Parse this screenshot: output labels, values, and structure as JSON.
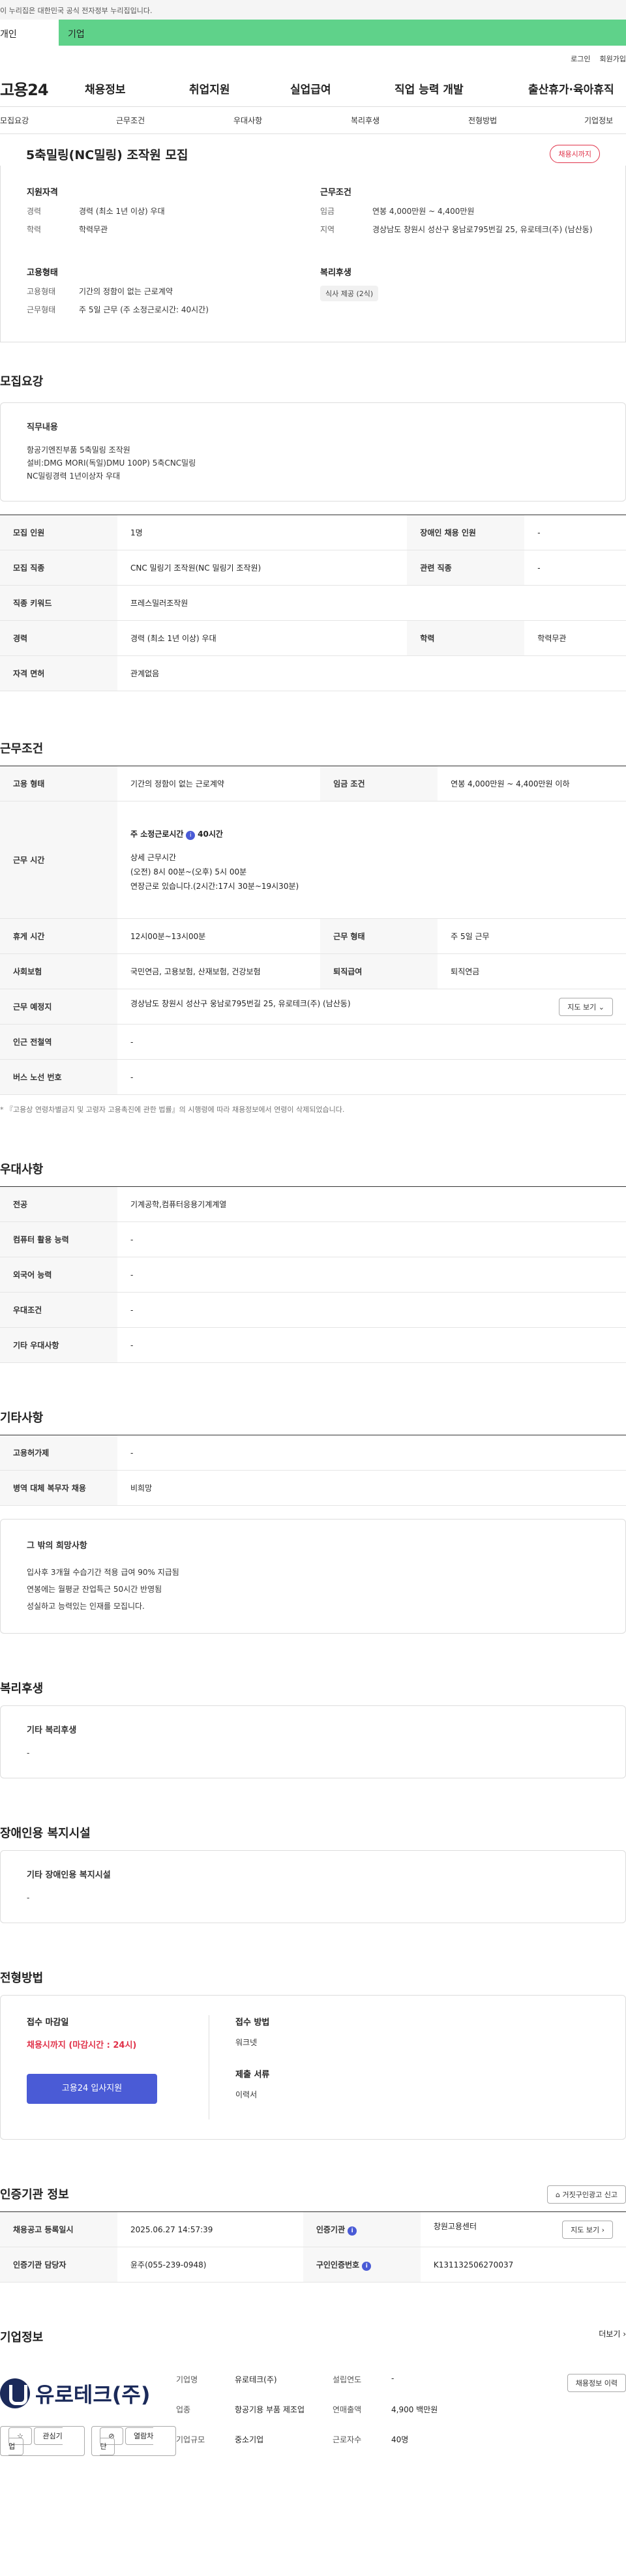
{
  "gov_bar": "이 누리집은 대한민국 공식 전자정부 누리집입니다.",
  "top_tabs": [
    "개인",
    "기업"
  ],
  "util": [
    "로그인",
    "회원가입"
  ],
  "gnb": {
    "logo": "고용24",
    "menu": [
      "채용정보",
      "취업지원",
      "실업급여",
      "직업 능력 개발",
      "출산휴가·육아휴직"
    ]
  },
  "subnav": [
    "모집요강",
    "근무조건",
    "우대사항",
    "복리후생",
    "전형방법",
    "기업정보"
  ],
  "job": {
    "title": "5축밀링(NC밀링) 조작원 모집",
    "badge": "채용시까지"
  },
  "summary": {
    "qual_title": "지원자격",
    "qual_rows": [
      {
        "k": "경력",
        "v": "경력 (최소 1년 이상) 우대"
      },
      {
        "k": "학력",
        "v": "학력무관"
      }
    ],
    "work_title": "근무조건",
    "work_rows": [
      {
        "k": "임금",
        "v": "연봉 4,000만원 ~ 4,400만원"
      },
      {
        "k": "지역",
        "v": "경상남도 창원시 성산구 웅남로795번길 25, 유로테크(주) (남산동)"
      }
    ],
    "emp_title": "고용형태",
    "emp_rows": [
      {
        "k": "고용형태",
        "v": "기간의 정함이 없는 근로계약"
      },
      {
        "k": "근무형태",
        "v": "주 5일 근무 (주 소정근로시간: 40시간)"
      }
    ],
    "welfare_title": "복리후생",
    "welfare_chip": "식사 제공 (2식)"
  },
  "recruit": {
    "title": "모집요강",
    "duty_title": "직무내용",
    "duty_lines": [
      "항공기엔진부품 5축밀링 조작원",
      "설비:DMG MORI(독일)DMU 100P) 5축CNC밀링",
      "NC밀링경력 1년이상자 우대"
    ],
    "rows": [
      [
        "모집 인원",
        "1명",
        "장애인 채용 인원",
        "-"
      ],
      [
        "모집 직종",
        "CNC 밀링기 조작원(NC 밀링기 조작원)",
        "관련 직종",
        "-"
      ],
      [
        "직종 키워드",
        "프레스밀러조작원"
      ],
      [
        "경력",
        "경력 (최소 1년 이상) 우대",
        "학력",
        "학력무관"
      ],
      [
        "자격 면허",
        "관계없음"
      ]
    ]
  },
  "conditions": {
    "title": "근무조건",
    "r1": [
      "고용 형태",
      "기간의 정함이 없는 근로계약",
      "임금 조건",
      "연봉 4,000만원 ~ 4,400만원 이하"
    ],
    "hours_label": "근무 시간",
    "hours_main": "주 소정근로시간",
    "hours_value": "40시간",
    "hours_detail_title": "상세 근무시간",
    "hours_detail": [
      "(오전) 8시 00분~(오후) 5시 00분",
      "연장근로 있습니다.(2시간:17시 30분~19시30분)"
    ],
    "r3": [
      "휴게 시간",
      "12시00분~13시00분",
      "근무 형태",
      "주 5일 근무"
    ],
    "r4": [
      "사회보험",
      "국민연금, 고용보험, 산재보험, 건강보험",
      "퇴직급여",
      "퇴직연금"
    ],
    "r5": [
      "근무 예정지",
      "경상남도 창원시 성산구 웅남로795번길 25, 유로테크(주) (남산동)",
      "지도 보기"
    ],
    "r6": [
      "인근 전철역",
      "-"
    ],
    "r7": [
      "버스 노선 번호",
      "-"
    ],
    "note": "* 『고용상 연령차별금지 및 고령자 고용촉진에 관한 법률』의 시행령에 따라 채용정보에서 연령이 삭제되었습니다."
  },
  "preference": {
    "title": "우대사항",
    "rows": [
      [
        "전공",
        "기계공학,컴퓨터응용기계계열"
      ],
      [
        "컴퓨터 활용 능력",
        "-"
      ],
      [
        "외국어 능력",
        "-"
      ],
      [
        "우대조건",
        "-"
      ],
      [
        "기타 우대사항",
        "-"
      ]
    ]
  },
  "etc": {
    "title": "기타사항",
    "rows": [
      [
        "고용허가제",
        "-"
      ],
      [
        "병역 대체 복무자 채용",
        "비희망"
      ]
    ],
    "wish_title": "그 밖의 희망사항",
    "wish_lines": [
      "입사후 3개월 수습기간 적용 급여 90% 지급됨",
      "연봉에는 월평균 잔업특근 50시간 반영됨",
      "성실하고 능력있는 인재를 모집니다."
    ]
  },
  "welfare": {
    "title": "복리후생",
    "sub": "기타 복리후생",
    "val": "-"
  },
  "disabled": {
    "title": "장애인용 복지시설",
    "sub": "기타 장애인용 복지시설",
    "val": "-"
  },
  "process": {
    "title": "전형방법",
    "deadline_label": "접수 마감일",
    "deadline": "채용시까지 (마감시간 : 24시)",
    "apply_button": "고용24 입사지원",
    "method_label": "접수 방법",
    "method": "워크넷",
    "docs_label": "제출 서류",
    "docs": "이력서"
  },
  "agency": {
    "title": "인증기관 정보",
    "report_button": "거짓구인광고 신고",
    "r1": [
      "채용공고 등록일시",
      "2025.06.27 14:57:39",
      "인증기관",
      "창원고용센터",
      "지도 보기"
    ],
    "r2": [
      "인증기관 담당자",
      "윤주(055-239-0948)",
      "구인인증번호",
      "K131132506270037"
    ]
  },
  "company": {
    "title": "기업정보",
    "more": "더보기",
    "logo_text": "유로테크(주)",
    "interest_button": "관심기업",
    "block_button": "열람차단",
    "info": [
      [
        "기업명",
        "유로테크(주)",
        "설립연도",
        "-"
      ],
      [
        "업종",
        "항공기용 부품 제조업",
        "연매출액",
        "4,900 백만원"
      ],
      [
        "기업규모",
        "중소기업",
        "근로자수",
        "40명"
      ]
    ],
    "jobs_button": "채용정보 이력"
  },
  "colors": {
    "accent_green": "#5fd28a",
    "accent_red": "#e0334a",
    "accent_blue": "#4a5bd6"
  }
}
